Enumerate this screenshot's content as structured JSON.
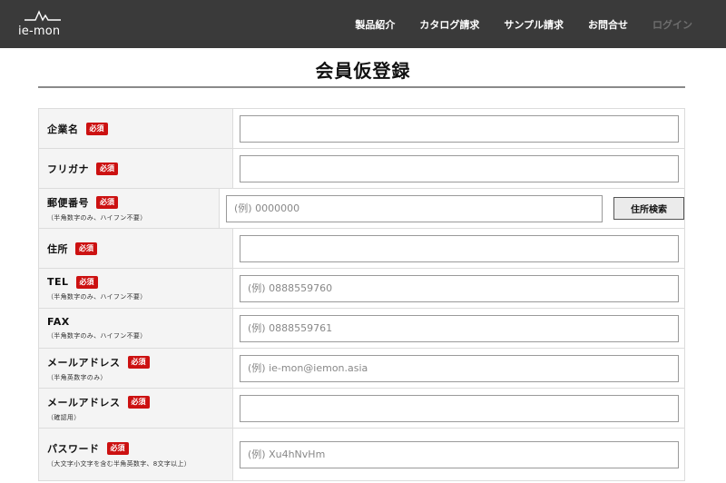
{
  "header": {
    "logo_text": "ie-mon",
    "nav": [
      {
        "label": "製品紹介"
      },
      {
        "label": "カタログ請求"
      },
      {
        "label": "サンプル請求"
      },
      {
        "label": "お問合せ"
      },
      {
        "label": "ログイン"
      }
    ]
  },
  "page": {
    "title": "会員仮登録"
  },
  "form": {
    "required_badge": "必須",
    "fields": {
      "company": {
        "label": "企業名",
        "value": "",
        "placeholder": ""
      },
      "furigana": {
        "label": "フリガナ",
        "value": "",
        "placeholder": ""
      },
      "postal": {
        "label": "郵便番号",
        "note": "（半角数字のみ、ハイフン不要）",
        "value": "",
        "placeholder": "(例) 0000000",
        "button": "住所検索"
      },
      "address": {
        "label": "住所",
        "value": "",
        "placeholder": ""
      },
      "tel": {
        "label": "TEL",
        "note": "（半角数字のみ、ハイフン不要）",
        "value": "",
        "placeholder": "(例) 0888559760"
      },
      "fax": {
        "label": "FAX",
        "note": "（半角数字のみ、ハイフン不要）",
        "value": "",
        "placeholder": "(例) 0888559761"
      },
      "email": {
        "label": "メールアドレス",
        "note": "（半角英数字のみ）",
        "value": "",
        "placeholder": "(例) ie-mon@iemon.asia"
      },
      "email_confirm": {
        "label": "メールアドレス",
        "note": "（確認用）",
        "value": "",
        "placeholder": ""
      },
      "password": {
        "label": "パスワード",
        "note": "（大文字小文字を含む半角英数字、8文字以上）",
        "value": "",
        "placeholder": "(例) Xu4hNvHm"
      }
    }
  }
}
